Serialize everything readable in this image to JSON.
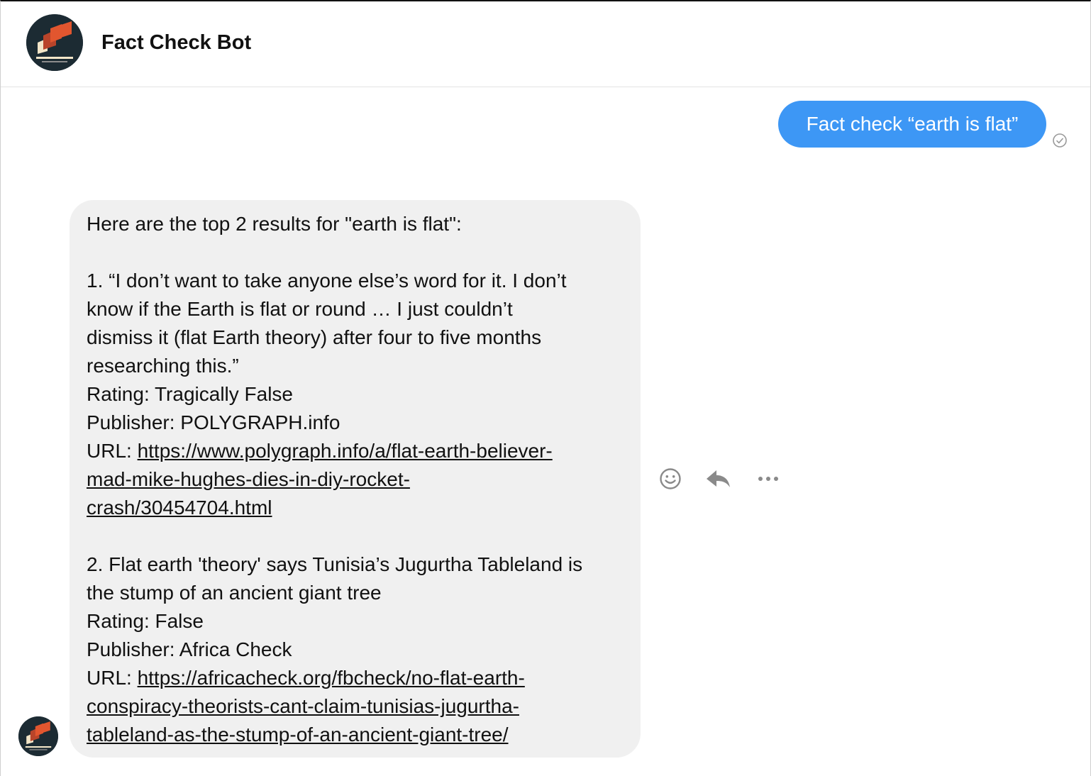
{
  "header": {
    "title": "Fact Check Bot",
    "avatar_icon": "fact-check-bot-logo"
  },
  "conversation": {
    "user_message": "Fact check “earth is flat”",
    "sent_status_icon": "check-circle-icon",
    "bot_reply": {
      "intro": "Here are the top 2 results for \"earth is flat\":",
      "results": [
        {
          "quote_lines": [
            "1. “I don’t want to take anyone else’s word for it. I don’t",
            "know if the Earth is flat or round … I just couldn’t",
            "dismiss it (flat Earth theory) after four to five months",
            "researching this.”"
          ],
          "rating": "Rating: Tragically False",
          "publisher": "Publisher: POLYGRAPH.info",
          "url_label": "URL: ",
          "url_lines": [
            "https://www.polygraph.info/a/flat-earth-believer-",
            "mad-mike-hughes-dies-in-diy-rocket-",
            "crash/30454704.html"
          ]
        },
        {
          "quote_lines": [
            "2. Flat earth 'theory' says Tunisia’s Jugurtha Tableland is",
            "the stump of an ancient giant tree"
          ],
          "rating": "Rating: False",
          "publisher": "Publisher: Africa Check",
          "url_label": "URL: ",
          "url_lines": [
            "https://africacheck.org/fbcheck/no-flat-earth-",
            "conspiracy-theorists-cant-claim-tunisias-jugurtha-",
            "tableland-as-the-stump-of-an-ancient-giant-tree/"
          ]
        }
      ]
    },
    "message_actions": [
      "smiley-icon",
      "reply-icon",
      "more-icon"
    ]
  },
  "colors": {
    "user_bubble": "#3d97f5",
    "bot_bubble": "#f0f0f0",
    "logo_bg": "#1c2b33",
    "logo_orange": "#e2562f",
    "logo_cream": "#f3e6c8"
  }
}
